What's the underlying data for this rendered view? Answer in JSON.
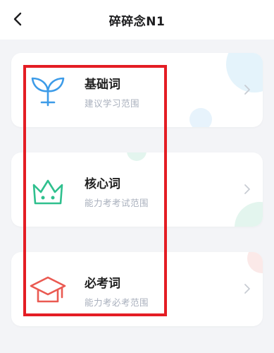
{
  "header": {
    "title": "碎碎念N1",
    "back_icon": "chevron-left-icon"
  },
  "categories": [
    {
      "name": "基础词",
      "desc": "建议学习范围",
      "icon": "sprout-icon",
      "color": "#3c9be8"
    },
    {
      "name": "核心词",
      "desc": "能力考考试范围",
      "icon": "crown-icon",
      "color": "#2fc08e"
    },
    {
      "name": "必考词",
      "desc": "能力考必考范围",
      "icon": "graduation-cap-icon",
      "color": "#ea5a52"
    }
  ],
  "colors": {
    "highlight_border": "#e41d24",
    "bubble": "#e6f4fb"
  }
}
